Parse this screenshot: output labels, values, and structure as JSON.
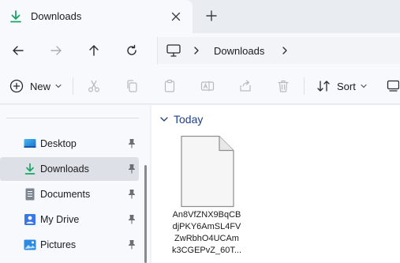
{
  "tab": {
    "title": "Downloads",
    "icon": "download-icon",
    "close_icon": "close-icon",
    "new_tab_icon": "plus-icon"
  },
  "nav": {
    "back_icon": "arrow-left-icon",
    "forward_icon": "arrow-right-icon",
    "up_icon": "arrow-up-icon",
    "refresh_icon": "refresh-icon"
  },
  "address": {
    "root_icon": "computer-icon",
    "segment": "Downloads"
  },
  "commands": {
    "new_label": "New",
    "sort_label": "Sort",
    "icons": [
      "cut-icon",
      "copy-icon",
      "paste-icon",
      "rename-icon",
      "share-icon",
      "delete-icon",
      "view-icon"
    ]
  },
  "sidebar": {
    "items": [
      {
        "label": "Desktop",
        "icon": "desktop-icon",
        "pinned": true,
        "selected": false
      },
      {
        "label": "Downloads",
        "icon": "download-icon",
        "pinned": true,
        "selected": true
      },
      {
        "label": "Documents",
        "icon": "documents-icon",
        "pinned": true,
        "selected": false
      },
      {
        "label": "My Drive",
        "icon": "drive-icon",
        "pinned": true,
        "selected": false
      },
      {
        "label": "Pictures",
        "icon": "pictures-icon",
        "pinned": true,
        "selected": false
      }
    ]
  },
  "main": {
    "group_label": "Today",
    "file": {
      "name_lines": [
        "An8VfZNX9BqCB",
        "djPKY6AmSL4FV",
        "ZwRbhO4UCAm",
        "k3CGEPvZ_60T..."
      ]
    }
  },
  "colors": {
    "accent": "#1f3f8a",
    "download_green": "#19a463",
    "selected_bg": "#dde1e7"
  }
}
